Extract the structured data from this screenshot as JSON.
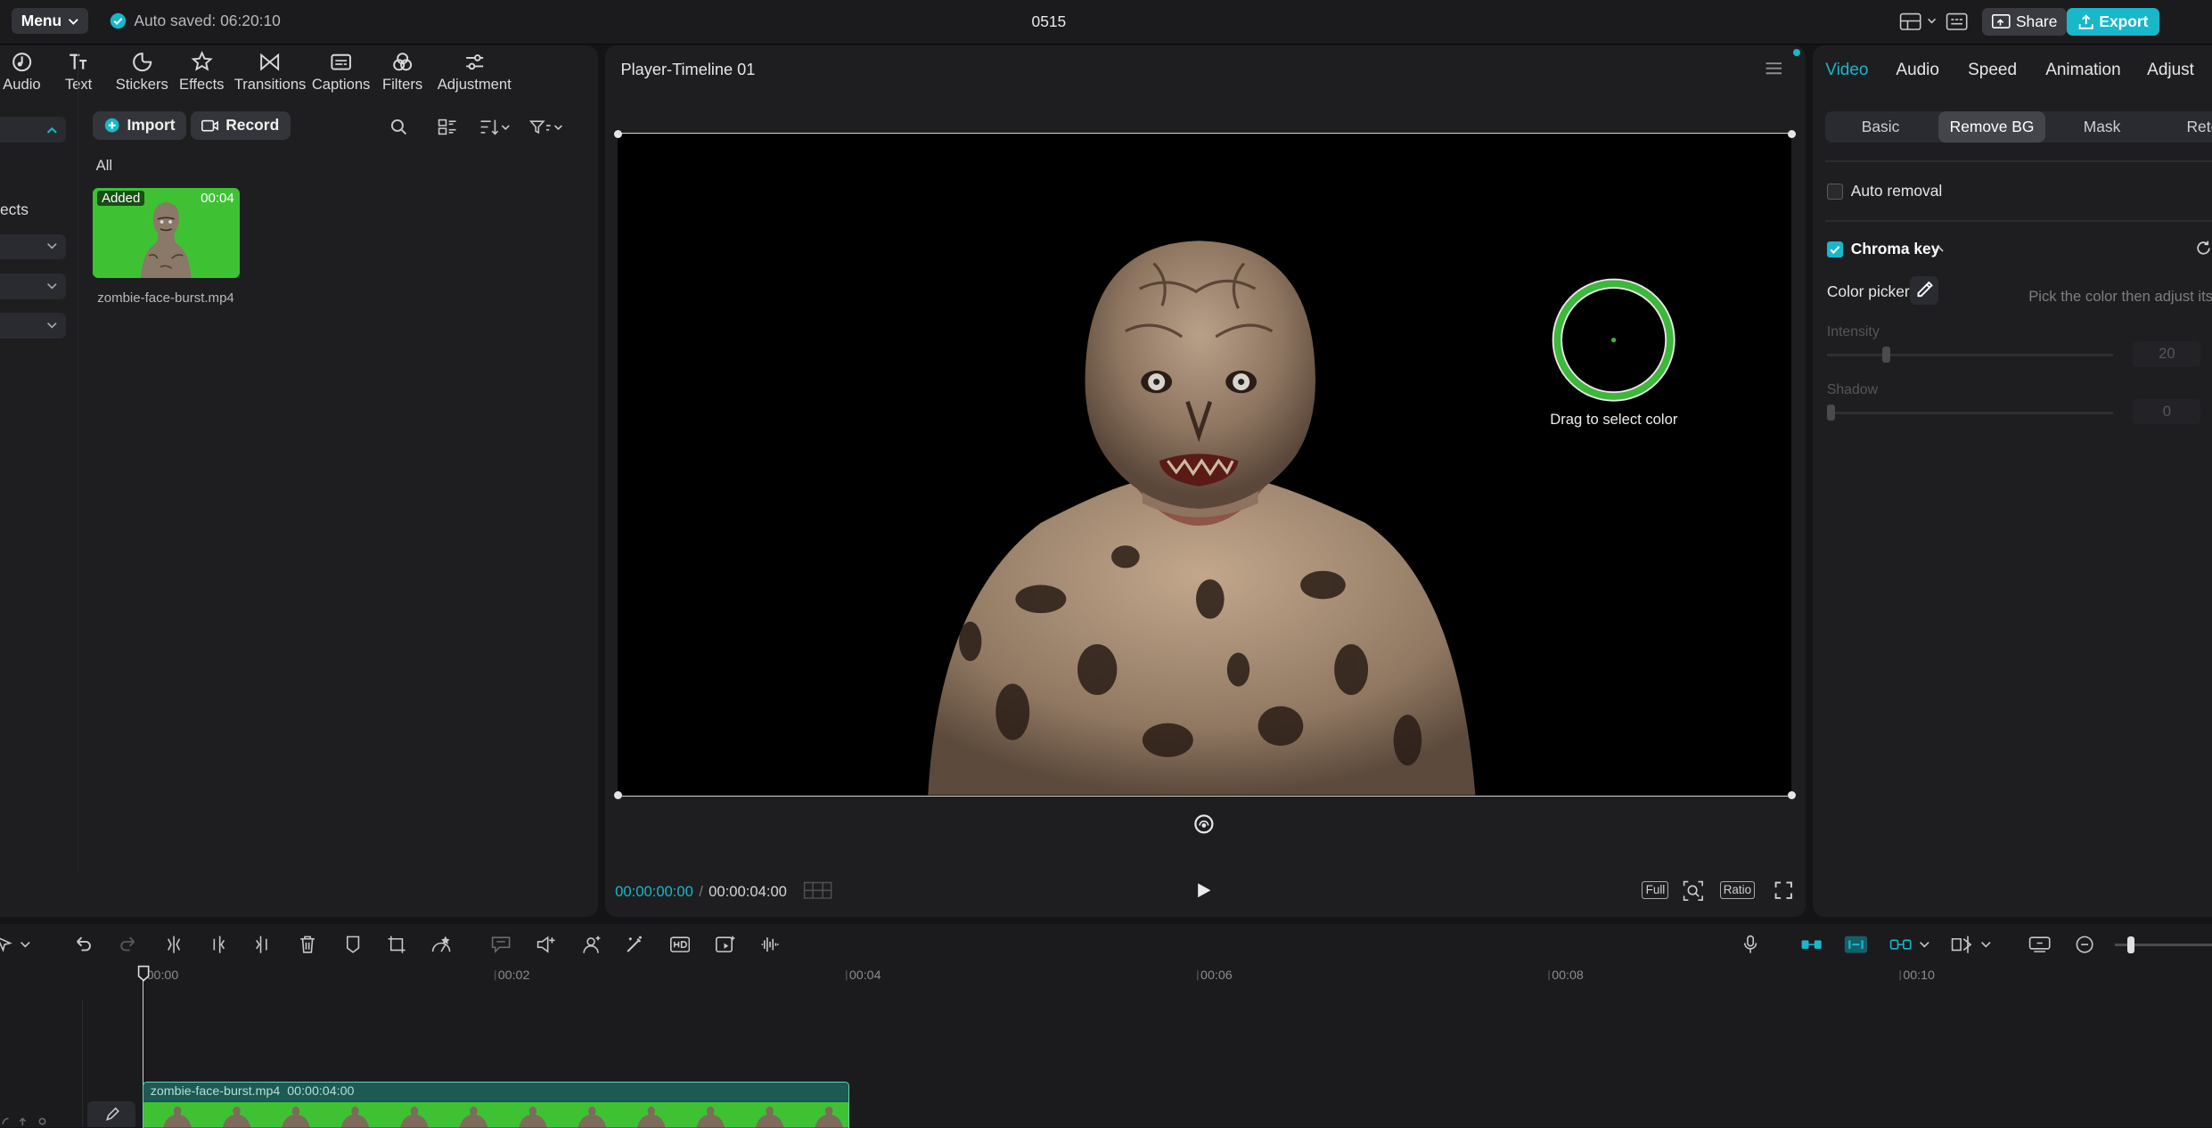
{
  "topbar": {
    "menu_label": "Menu",
    "autosave_text": "Auto saved: 06:20:10",
    "project_title": "0515",
    "share_label": "Share",
    "export_label": "Export"
  },
  "tools": [
    {
      "label": "Audio",
      "icon": "audio-icon"
    },
    {
      "label": "Text",
      "icon": "text-icon"
    },
    {
      "label": "Stickers",
      "icon": "stickers-icon"
    },
    {
      "label": "Effects",
      "icon": "effects-icon"
    },
    {
      "label": "Transitions",
      "icon": "transitions-icon"
    },
    {
      "label": "Captions",
      "icon": "captions-icon"
    },
    {
      "label": "Filters",
      "icon": "filters-icon"
    },
    {
      "label": "Adjustment",
      "icon": "adjustment-icon"
    }
  ],
  "media": {
    "category_partial": "ects",
    "import_label": "Import",
    "record_label": "Record",
    "filter_all": "All",
    "item": {
      "badge": "Added",
      "duration": "00:04",
      "filename": "zombie-face-burst.mp4"
    }
  },
  "player": {
    "title": "Player-Timeline 01",
    "picker_hint": "Drag to select color",
    "current_time": "00:00:00:00",
    "separator": "/",
    "total_time": "00:00:04:00",
    "full_label": "Full",
    "ratio_label": "Ratio"
  },
  "properties": {
    "tabs": [
      "Video",
      "Audio",
      "Speed",
      "Animation",
      "Adjust"
    ],
    "active_tab": "Video",
    "subtabs": [
      "Basic",
      "Remove BG",
      "Mask",
      "Retc"
    ],
    "active_subtab": "Remove BG",
    "auto_removal_label": "Auto removal",
    "auto_removal_checked": false,
    "chroma_key_label": "Chroma key",
    "chroma_key_checked": true,
    "color_picker_label": "Color picker",
    "color_picker_hint": "Pick the color then adjust its",
    "intensity_label": "Intensity",
    "intensity_value": "20",
    "shadow_label": "Shadow",
    "shadow_value": "0"
  },
  "timeline": {
    "ruler": [
      "00:00",
      "00:02",
      "00:04",
      "00:06",
      "00:08",
      "00:10"
    ],
    "clip_name": "zombie-face-burst.mp4",
    "clip_duration": "00:00:04:00"
  },
  "colors": {
    "accent": "#18b7c9",
    "chroma_green": "#3ec234",
    "picker_ring": "#3cb83a"
  }
}
